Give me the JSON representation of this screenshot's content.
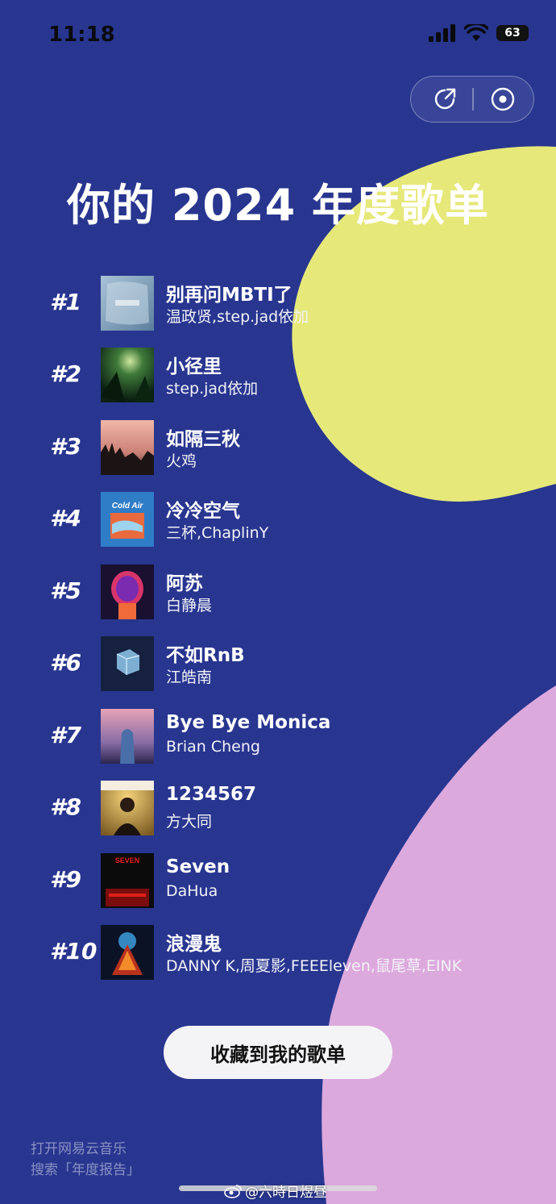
{
  "status_bar": {
    "time": "11:18",
    "battery": "63"
  },
  "header": {
    "title": "你的 2024 年度歌单"
  },
  "songs": [
    {
      "rank": "#1",
      "title": "别再问MBTI了",
      "artist": "温政贤,step.jad依加"
    },
    {
      "rank": "#2",
      "title": "小径里",
      "artist": "step.jad依加"
    },
    {
      "rank": "#3",
      "title": "如隔三秋",
      "artist": "火鸡"
    },
    {
      "rank": "#4",
      "title": "冷冷空气",
      "artist": "三杯,ChaplinY"
    },
    {
      "rank": "#5",
      "title": "阿苏",
      "artist": "白静晨"
    },
    {
      "rank": "#6",
      "title": "不如RnB",
      "artist": "江皓南"
    },
    {
      "rank": "#7",
      "title": "Bye Bye Monica",
      "artist": "Brian Cheng"
    },
    {
      "rank": "#8",
      "title": "1234567",
      "artist": "方大同"
    },
    {
      "rank": "#9",
      "title": "Seven",
      "artist": "DaHua"
    },
    {
      "rank": "#10",
      "title": "浪漫鬼",
      "artist": "DANNY K,周夏影,FEEEleven,鼠尾草,EINK"
    }
  ],
  "covers": {
    "c4_text": "Cold Air",
    "c9_text": "SEVEN"
  },
  "actions": {
    "save_label": "收藏到我的歌单"
  },
  "footer": {
    "hint_line1": "打开网易云音乐",
    "hint_line2": "搜索「年度报告」"
  },
  "watermark": {
    "text": "@六時日煜昼"
  },
  "icons": {
    "share": "share-arrow-icon",
    "close": "target-close-icon",
    "signal": "signal-bars-icon",
    "wifi": "wifi-icon",
    "battery": "battery-icon",
    "weibo": "weibo-icon"
  },
  "colors": {
    "background": "#283690",
    "yellow_blob": "#E6E87A",
    "pink_blob": "#DCA9DD",
    "button_bg": "#F4F4F6"
  }
}
